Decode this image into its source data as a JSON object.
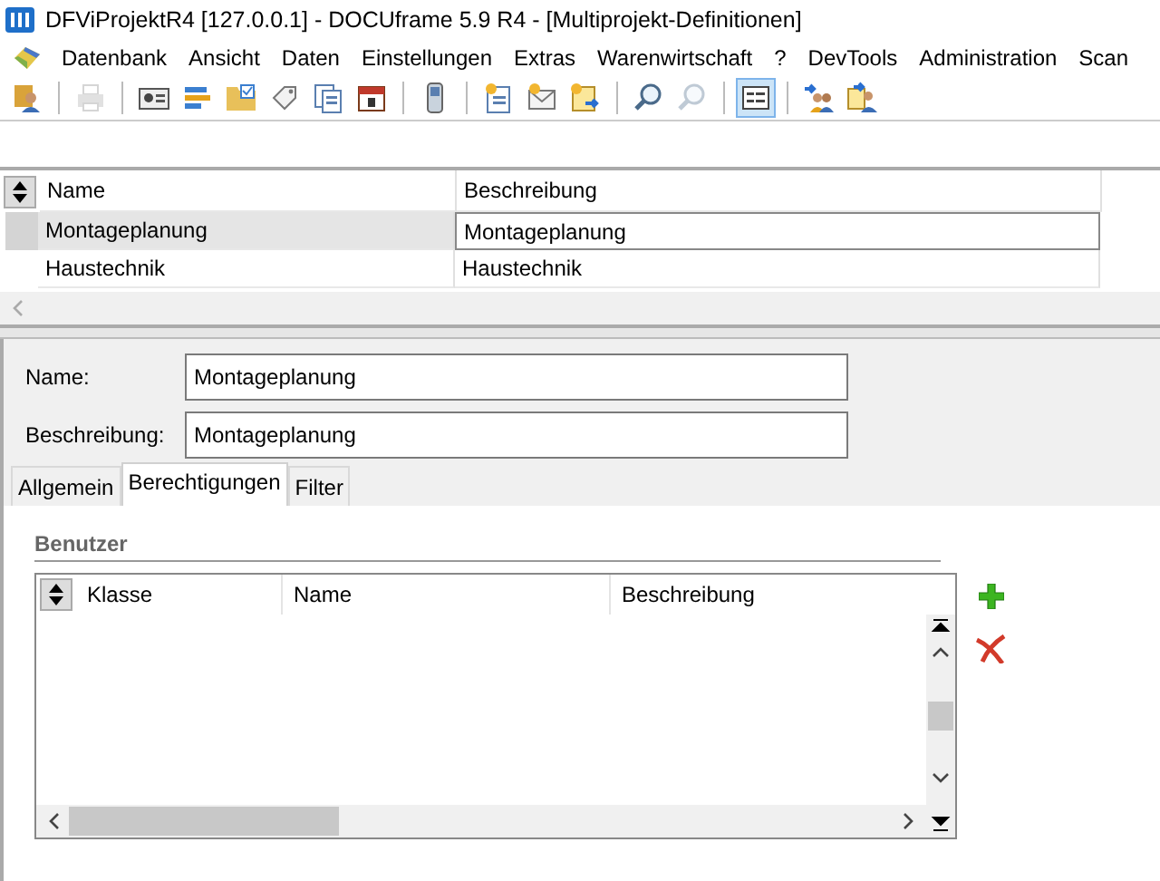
{
  "window": {
    "title": "DFViProjektR4 [127.0.0.1] - DOCUframe 5.9 R4 - [Multiprojekt-Definitionen]"
  },
  "menu": [
    "Datenbank",
    "Ansicht",
    "Daten",
    "Einstellungen",
    "Extras",
    "Warenwirtschaft",
    "?",
    "DevTools",
    "Administration",
    "Scan"
  ],
  "toolbar": {
    "groups": [
      [
        {
          "disabled": false,
          "pressed": false
        }
      ],
      [
        {
          "disabled": true,
          "pressed": false
        }
      ],
      [
        {
          "disabled": false,
          "pressed": false
        },
        {
          "disabled": false,
          "pressed": false
        },
        {
          "disabled": false,
          "pressed": false
        },
        {
          "disabled": false,
          "pressed": false
        },
        {
          "disabled": false,
          "pressed": false
        },
        {
          "disabled": false,
          "pressed": false
        }
      ],
      [
        {
          "disabled": false,
          "pressed": false
        }
      ],
      [
        {
          "disabled": false,
          "pressed": false
        },
        {
          "disabled": false,
          "pressed": false
        },
        {
          "disabled": false,
          "pressed": false
        }
      ],
      [
        {
          "disabled": false,
          "pressed": false
        },
        {
          "disabled": true,
          "pressed": false
        }
      ],
      [
        {
          "disabled": false,
          "pressed": true
        }
      ],
      [
        {
          "disabled": false,
          "pressed": false
        },
        {
          "disabled": false,
          "pressed": false
        }
      ]
    ]
  },
  "table": {
    "columns": [
      "Name",
      "Beschreibung"
    ],
    "rows": [
      {
        "name": "Montageplanung",
        "description": "Montageplanung",
        "selected": true
      },
      {
        "name": "Haustechnik",
        "description": "Haustechnik",
        "selected": false
      }
    ]
  },
  "form": {
    "fields": [
      {
        "label": "Name:",
        "value": "Montageplanung"
      },
      {
        "label": "Beschreibung:",
        "value": "Montageplanung"
      }
    ]
  },
  "tabs": [
    {
      "label": "Allgemein",
      "selected": false
    },
    {
      "label": "Berechtigungen",
      "selected": true
    },
    {
      "label": "Filter",
      "selected": false
    }
  ],
  "users": {
    "heading": "Benutzer",
    "columns": [
      "Klasse",
      "Name",
      "Beschreibung"
    ]
  }
}
